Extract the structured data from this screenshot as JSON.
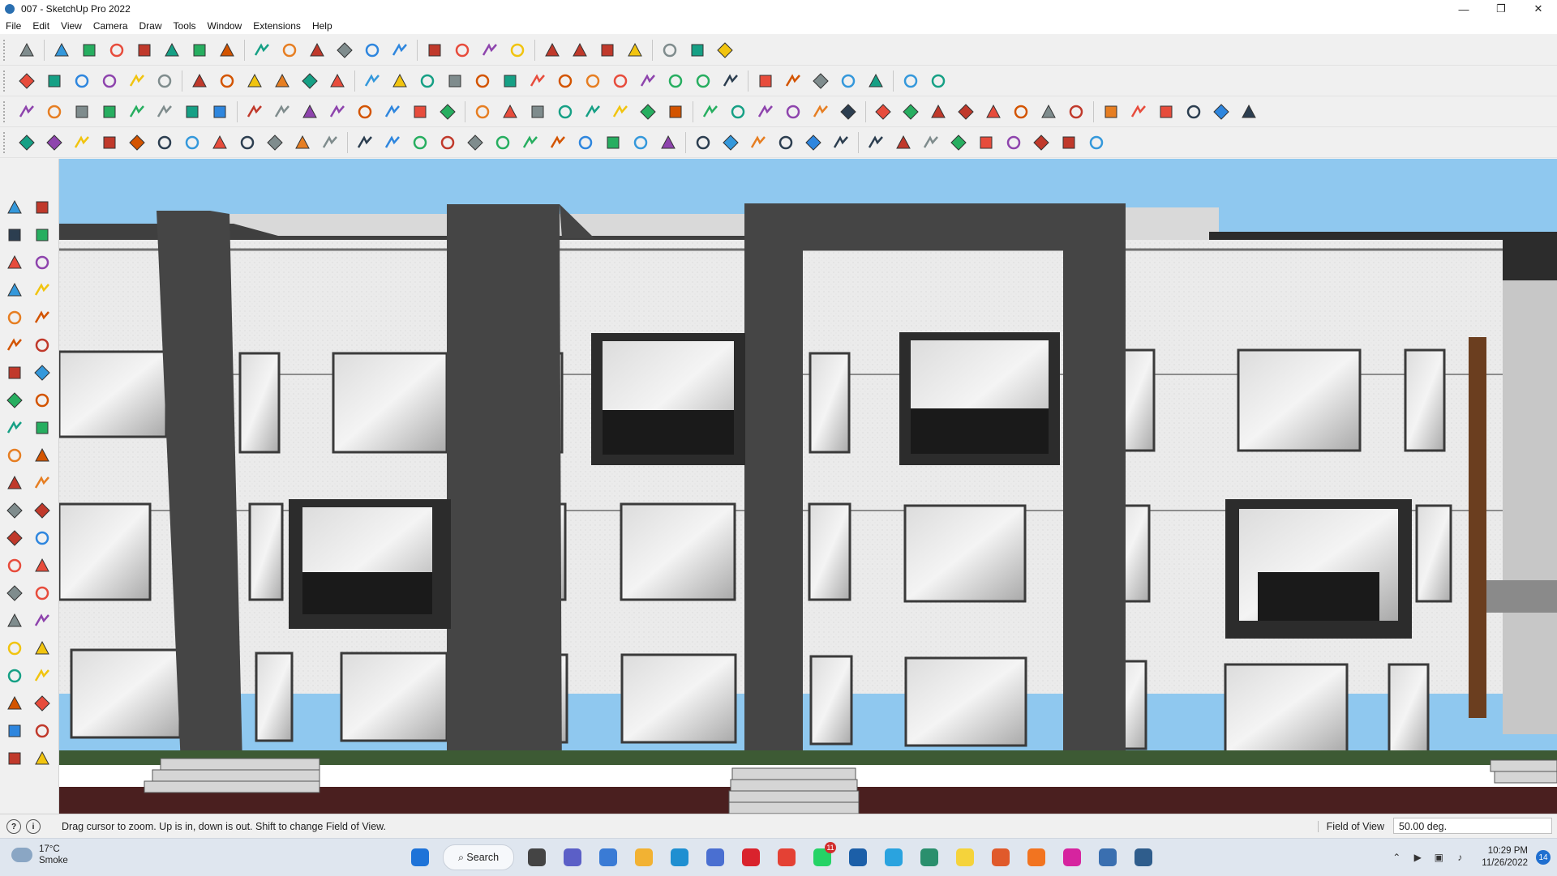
{
  "window": {
    "title": "007 - SketchUp Pro 2022",
    "controls": [
      "minimize",
      "maximize",
      "close"
    ]
  },
  "menu": [
    "File",
    "Edit",
    "View",
    "Camera",
    "Draw",
    "Tools",
    "Window",
    "Extensions",
    "Help"
  ],
  "toolbars": {
    "row1": [
      "zoom-icon",
      "select-icon",
      "eraser-icon",
      "pencil-icon",
      "arc-icon",
      "shape-icon",
      "push-pull-icon",
      "follow-me-icon",
      "move-icon",
      "rotate-icon",
      "scale-icon",
      "tape-measure-icon",
      "text-icon",
      "paint-bucket-icon",
      "orbit-icon",
      "pan-icon",
      "zoom-window-icon",
      "zoom-extents-icon",
      "components-icon",
      "styles-icon",
      "layers-icon",
      "scenes-icon",
      "warehouse-icon",
      "extension-warehouse-icon",
      "sandbox-icon"
    ],
    "row2": [
      "top-view-icon",
      "iso-view-icon",
      "front-view-icon",
      "right-view-icon",
      "back-view-icon",
      "left-view-icon",
      "xray-icon",
      "wireframe-icon",
      "hidden-line-icon",
      "shaded-icon",
      "textured-icon",
      "monochrome-icon",
      "section-plane-icon",
      "section-fill-icon",
      "smoove-icon",
      "stamp-icon",
      "drape-icon",
      "add-detail-icon",
      "flip-edge-icon",
      "from-contours-icon",
      "from-scratch-icon",
      "solid-union-icon",
      "solid-subtract-icon",
      "solid-trim-icon",
      "solid-split-icon",
      "outer-shell-icon",
      "red-cube-icon",
      "blue-cube-icon",
      "green-cube-icon",
      "orange-cube-icon",
      "magenta-cube-icon",
      "export-icon",
      "import-icon"
    ],
    "row3": [
      "weld-icon",
      "curve-icon",
      "bezier-icon",
      "polyline-icon",
      "ring-icon",
      "cone-icon",
      "sphere-icon",
      "torus-icon",
      "helix-icon",
      "box-icon",
      "cylinder-icon",
      "pipe-icon",
      "lathe-icon",
      "loft-icon",
      "extrude-icon",
      "shell-icon",
      "mirror-icon",
      "array-icon",
      "scale-tool-icon",
      "stretch-icon",
      "bend-icon",
      "twist-icon",
      "taper-icon",
      "spherify-icon",
      "relax-icon",
      "subdivide-icon",
      "fillet-icon",
      "chamfer-icon",
      "offset-icon",
      "joint-icon",
      "stair-icon",
      "railing-icon",
      "wall-icon",
      "door-icon",
      "window-tool-icon",
      "roof-icon",
      "beam-icon",
      "column-icon",
      "truss-icon",
      "path-icon",
      "spline-icon",
      "grid-icon",
      "terrain-icon",
      "cloth-icon"
    ],
    "row4": [
      "blue-plane-icon",
      "cyan-plane-icon",
      "yellow-plane-icon",
      "green-plane-icon",
      "red-plane-icon",
      "gray-plane-icon",
      "orange-curve-icon",
      "red-square-icon",
      "list-icon",
      "page-icon",
      "box-3d-icon",
      "weld-tool-icon",
      "rail-icon",
      "nodes-icon",
      "cross-icon",
      "green-cross-icon",
      "scissors-icon",
      "cone-blue-icon",
      "house-icon",
      "triangle-icon",
      "spiral-icon",
      "curl-icon",
      "loop-icon",
      "star-icon",
      "bucket-icon",
      "undo-icon",
      "green-frame-icon",
      "shift-icon",
      "copy-icon",
      "cut-icon",
      "tag-icon",
      "grid-a-icon",
      "grid-b-icon",
      "grid-c-icon",
      "grid-d-icon",
      "grid-e-icon",
      "scatter-icon",
      "lasso-icon",
      "merge-icon"
    ]
  },
  "left_toolbar": [
    "select-icon",
    "orbit-icon",
    "paint-icon",
    "eraser-icon",
    "component-icon",
    "tape-icon",
    "line-icon",
    "freehand-icon",
    "rectangle-icon",
    "rotated-rect-icon",
    "circle-icon",
    "polygon-icon",
    "arc-icon",
    "pie-icon",
    "arc-3pt-icon",
    "two-point-arc-icon",
    "move-icon",
    "push-pull-icon",
    "rotate-icon",
    "follow-me-icon",
    "scale-icon",
    "offset-icon",
    "tape-measure-icon",
    "dimension-icon",
    "protractor-icon",
    "text-icon",
    "axes-icon",
    "3d-text-icon",
    "orbit-tool-icon",
    "pan-icon",
    "zoom-icon",
    "zoom-window-icon",
    "zoom-extents-icon",
    "previous-view-icon",
    "walk-icon",
    "look-around-icon",
    "footprints-icon",
    "position-camera-icon",
    "section-icon",
    "section-display-icon",
    "layers-icon",
    "scenes-icon"
  ],
  "status": {
    "message": "Drag cursor to zoom.  Up is in, down is out. Shift to change Field of View.",
    "fov_label": "Field of View",
    "fov_value": "50.00 deg."
  },
  "taskbar": {
    "weather_temp": "17°C",
    "weather_desc": "Smoke",
    "search_label": "Search",
    "apps": [
      "windows-start-icon",
      "task-view-icon",
      "chat-icon",
      "calculator-icon",
      "file-explorer-icon",
      "edge-icon",
      "store-icon",
      "opera-icon",
      "chrome-icon",
      "whatsapp-icon",
      "sketchup-icon",
      "telegram-icon",
      "sketchup-layout-icon",
      "sticky-notes-icon",
      "brave-icon",
      "soundcloud-icon",
      "instagram-icon",
      "photos-icon",
      "style-builder-icon"
    ],
    "whatsapp_badge": "11",
    "time": "10:29 PM",
    "date": "11/26/2022",
    "notifications": "14"
  },
  "colors": {
    "sky": "#8fc8ef",
    "wall": "#e9e9e9",
    "frame": "#454545",
    "grass": "#3d5a34",
    "ground": "#4a1f1f"
  }
}
